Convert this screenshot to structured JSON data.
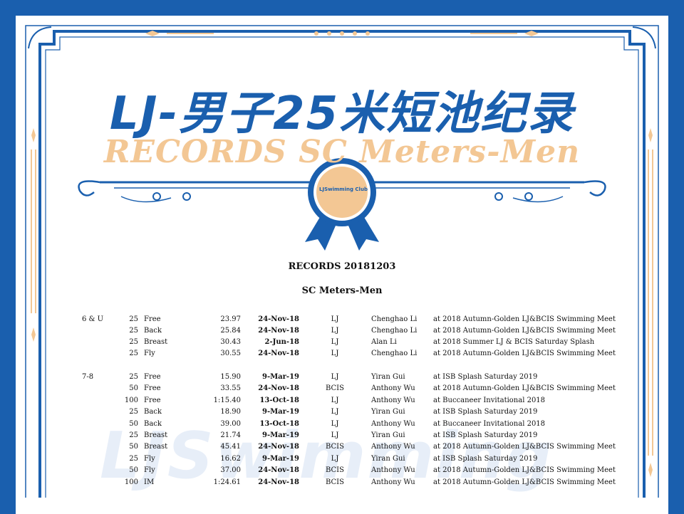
{
  "title_zh": "LJ-男子25米短池纪录",
  "title_en": "RECORDS SC Meters-Men",
  "badge_text": "LJSwimming Club",
  "watermark": "LJSwimming",
  "records_title": "RECORDS  20181203",
  "records_subtitle": "SC Meters-Men",
  "colors": {
    "blue": "#1a5fae",
    "gold": "#f3c794"
  },
  "rows": [
    {
      "age": "6 & U",
      "dist": "25",
      "stroke": "Free",
      "time": "23.97",
      "date": "24-Nov-18",
      "club": "LJ",
      "name": "Chenghao Li",
      "meet": "at 2018 Autumn-Golden LJ&BCIS Swimming Meet"
    },
    {
      "age": "",
      "dist": "25",
      "stroke": "Back",
      "time": "25.84",
      "date": "24-Nov-18",
      "club": "LJ",
      "name": "Chenghao Li",
      "meet": "at 2018 Autumn-Golden LJ&BCIS Swimming Meet"
    },
    {
      "age": "",
      "dist": "25",
      "stroke": "Breast",
      "time": "30.43",
      "date": "2-Jun-18",
      "club": "LJ",
      "name": "Alan Li",
      "meet": "at 2018 Summer LJ & BCIS Saturday Splash"
    },
    {
      "age": "",
      "dist": "25",
      "stroke": "Fly",
      "time": "30.55",
      "date": "24-Nov-18",
      "club": "LJ",
      "name": "Chenghao Li",
      "meet": "at 2018 Autumn-Golden LJ&BCIS Swimming Meet"
    },
    {
      "age": "7-8",
      "dist": "25",
      "stroke": "Free",
      "time": "15.90",
      "date": "9-Mar-19",
      "club": "LJ",
      "name": "Yiran Gui",
      "meet": "at ISB Splash Saturday 2019"
    },
    {
      "age": "",
      "dist": "50",
      "stroke": "Free",
      "time": "33.55",
      "date": "24-Nov-18",
      "club": "BCIS",
      "name": "Anthony Wu",
      "meet": "at 2018 Autumn-Golden LJ&BCIS Swimming Meet"
    },
    {
      "age": "",
      "dist": "100",
      "stroke": "Free",
      "time": "1:15.40",
      "date": "13-Oct-18",
      "club": "LJ",
      "name": "Anthony Wu",
      "meet": "at Buccaneer Invitational 2018"
    },
    {
      "age": "",
      "dist": "25",
      "stroke": "Back",
      "time": "18.90",
      "date": "9-Mar-19",
      "club": "LJ",
      "name": "Yiran Gui",
      "meet": "at ISB Splash Saturday 2019"
    },
    {
      "age": "",
      "dist": "50",
      "stroke": "Back",
      "time": "39.00",
      "date": "13-Oct-18",
      "club": "LJ",
      "name": "Anthony Wu",
      "meet": "at Buccaneer Invitational 2018"
    },
    {
      "age": "",
      "dist": "25",
      "stroke": "Breast",
      "time": "21.74",
      "date": "9-Mar-19",
      "club": "LJ",
      "name": "Yiran Gui",
      "meet": "at ISB Splash Saturday 2019"
    },
    {
      "age": "",
      "dist": "50",
      "stroke": "Breast",
      "time": "45.41",
      "date": "24-Nov-18",
      "club": "BCIS",
      "name": "Anthony Wu",
      "meet": "at 2018 Autumn-Golden LJ&BCIS Swimming Meet"
    },
    {
      "age": "",
      "dist": "25",
      "stroke": "Fly",
      "time": "16.62",
      "date": "9-Mar-19",
      "club": "LJ",
      "name": "Yiran Gui",
      "meet": "at ISB Splash Saturday 2019"
    },
    {
      "age": "",
      "dist": "50",
      "stroke": "Fly",
      "time": "37.00",
      "date": "24-Nov-18",
      "club": "BCIS",
      "name": "Anthony Wu",
      "meet": "at 2018 Autumn-Golden LJ&BCIS Swimming Meet"
    },
    {
      "age": "",
      "dist": "100",
      "stroke": "IM",
      "time": "1:24.61",
      "date": "24-Nov-18",
      "club": "BCIS",
      "name": "Anthony Wu",
      "meet": "at 2018 Autumn-Golden LJ&BCIS Swimming Meet"
    }
  ]
}
